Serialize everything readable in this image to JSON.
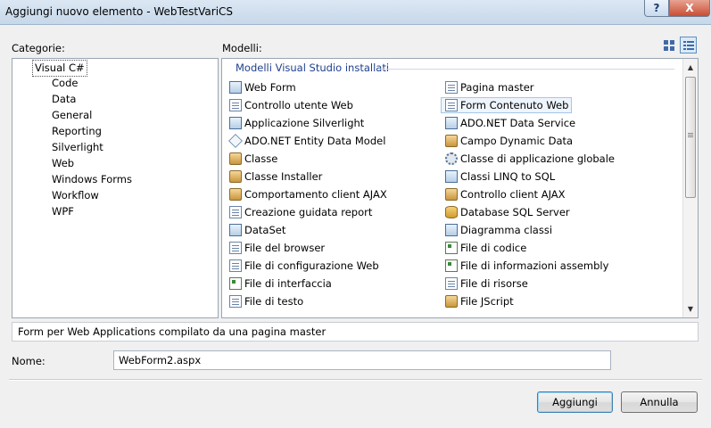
{
  "window": {
    "title": "Aggiungi nuovo elemento - WebTestVariCS",
    "help_glyph": "?",
    "close_glyph": "X"
  },
  "labels": {
    "categories": "Categorie:",
    "templates": "Modelli:",
    "name": "Nome:"
  },
  "categories": {
    "root": "Visual C#",
    "children": [
      "Code",
      "Data",
      "General",
      "Reporting",
      "Silverlight",
      "Web",
      "Windows Forms",
      "Workflow",
      "WPF"
    ]
  },
  "templates": {
    "group": "Modelli Visual Studio installati",
    "left_column": [
      {
        "label": "Web Form",
        "icon": "web-form-icon"
      },
      {
        "label": "Controllo utente Web",
        "icon": "user-control-icon"
      },
      {
        "label": "Applicazione Silverlight",
        "icon": "silverlight-icon"
      },
      {
        "label": "ADO.NET Entity Data Model",
        "icon": "entity-model-icon"
      },
      {
        "label": "Classe",
        "icon": "class-icon"
      },
      {
        "label": "Classe Installer",
        "icon": "installer-class-icon"
      },
      {
        "label": "Comportamento client AJAX",
        "icon": "ajax-behavior-icon"
      },
      {
        "label": "Creazione guidata report",
        "icon": "report-wizard-icon"
      },
      {
        "label": "DataSet",
        "icon": "dataset-icon"
      },
      {
        "label": "File del browser",
        "icon": "browser-file-icon"
      },
      {
        "label": "File di configurazione Web",
        "icon": "web-config-icon"
      },
      {
        "label": "File di interfaccia",
        "icon": "interface-file-icon"
      },
      {
        "label": "File di testo",
        "icon": "text-file-icon"
      }
    ],
    "right_column": [
      {
        "label": "Pagina master",
        "icon": "master-page-icon"
      },
      {
        "label": "Form Contenuto Web",
        "icon": "content-form-icon"
      },
      {
        "label": "ADO.NET Data Service",
        "icon": "data-service-icon"
      },
      {
        "label": "Campo Dynamic Data",
        "icon": "dynamic-data-icon"
      },
      {
        "label": "Classe di applicazione globale",
        "icon": "global-app-icon"
      },
      {
        "label": "Classi LINQ to SQL",
        "icon": "linq-icon"
      },
      {
        "label": "Controllo client AJAX",
        "icon": "ajax-control-icon"
      },
      {
        "label": "Database SQL Server",
        "icon": "database-icon"
      },
      {
        "label": "Diagramma classi",
        "icon": "class-diagram-icon"
      },
      {
        "label": "File di codice",
        "icon": "code-file-icon"
      },
      {
        "label": "File di informazioni assembly",
        "icon": "assembly-info-icon"
      },
      {
        "label": "File di risorse",
        "icon": "resource-file-icon"
      },
      {
        "label": "File JScript",
        "icon": "jscript-icon"
      }
    ],
    "selected": "Form Contenuto Web"
  },
  "description": "Form per Web Applications compilato da una pagina master",
  "name_value": "WebForm2.aspx",
  "buttons": {
    "add": "Aggiungi",
    "cancel": "Annulla"
  }
}
